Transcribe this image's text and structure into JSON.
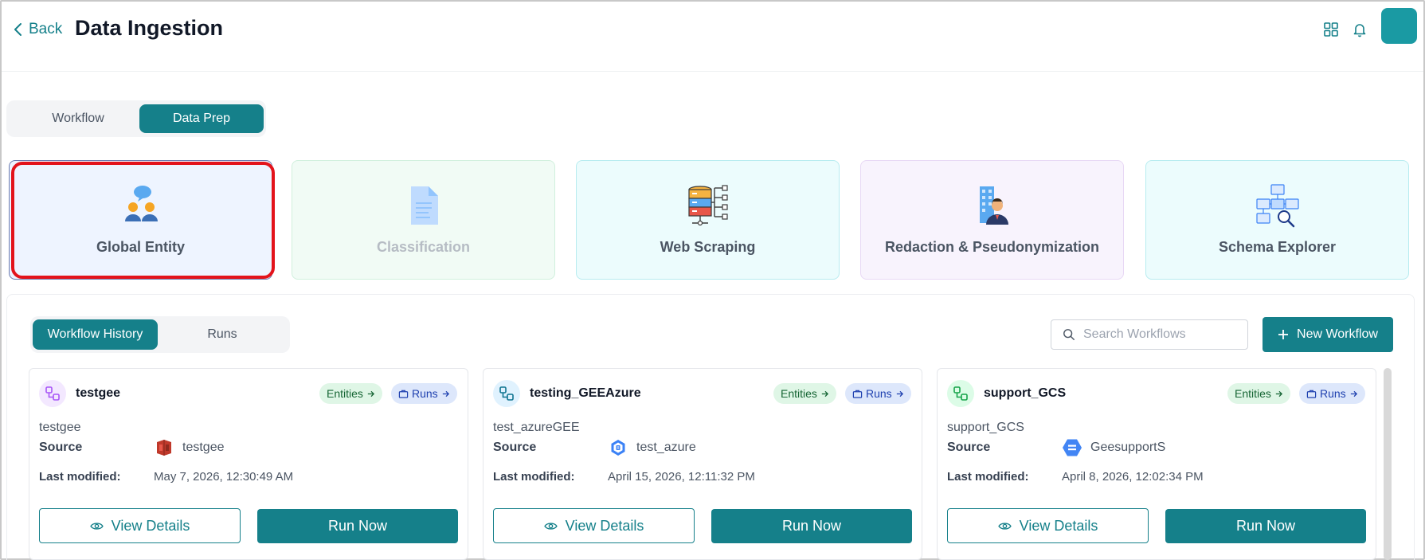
{
  "header": {
    "back_label": "Back",
    "title": "Data Ingestion",
    "icons": [
      "grid-icon",
      "bell-icon"
    ]
  },
  "top_tabs": [
    {
      "label": "Workflow",
      "active": false
    },
    {
      "label": "Data Prep",
      "active": true
    }
  ],
  "features": [
    {
      "label": "Global Entity",
      "icon": "global-entity-icon",
      "selected": true
    },
    {
      "label": "Classification",
      "icon": "document-icon",
      "disabled": true
    },
    {
      "label": "Web Scraping",
      "icon": "database-network-icon"
    },
    {
      "label": "Redaction & Pseudonymization",
      "icon": "person-building-icon"
    },
    {
      "label": "Schema Explorer",
      "icon": "schema-search-icon"
    }
  ],
  "history": {
    "tabs": [
      {
        "label": "Workflow History",
        "active": true
      },
      {
        "label": "Runs",
        "active": false
      }
    ],
    "search_placeholder": "Search Workflows",
    "new_workflow_label": "New Workflow"
  },
  "workflows": [
    {
      "title": "testgee",
      "icon_color": "#a855f7",
      "entities_label": "Entities",
      "runs_label": "Runs",
      "description": "testgee",
      "source_label": "Source",
      "source_name": "testgee",
      "source_icon": "amazon-s3-icon",
      "modified_label": "Last modified:",
      "modified_value": "May 7, 2026, 12:30:49 AM",
      "view_label": "View Details",
      "run_label": "Run Now"
    },
    {
      "title": "testing_GEEAzure",
      "icon_color": "#0e7490",
      "entities_label": "Entities",
      "runs_label": "Runs",
      "description": "test_azureGEE",
      "source_label": "Source",
      "source_name": "test_azure",
      "source_icon": "azure-storage-icon",
      "modified_label": "Last modified:",
      "modified_value": "April 15, 2026, 12:11:32 PM",
      "view_label": "View Details",
      "run_label": "Run Now"
    },
    {
      "title": "support_GCS",
      "icon_color": "#16a34a",
      "entities_label": "Entities",
      "runs_label": "Runs",
      "description": "support_GCS",
      "source_label": "Source",
      "source_name": "GeesupportS",
      "source_icon": "google-cloud-storage-icon",
      "modified_label": "Last modified:",
      "modified_value": "April 8, 2026, 12:02:34 PM",
      "view_label": "View Details",
      "run_label": "Run Now"
    }
  ],
  "colors": {
    "accent": "#15808a",
    "highlight": "#e3131b"
  }
}
